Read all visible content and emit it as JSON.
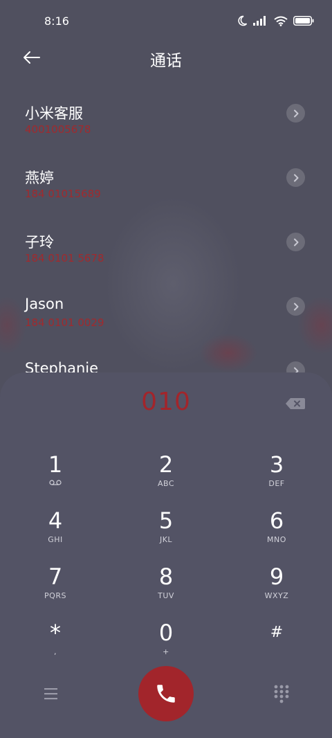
{
  "status_bar": {
    "time": "8:16"
  },
  "header": {
    "title": "通话"
  },
  "contacts": [
    {
      "name": "小米客服",
      "number": "4001005678"
    },
    {
      "name": "燕婷",
      "number": "184 01015689"
    },
    {
      "name": "子玲",
      "number": "184 0101 5678"
    },
    {
      "name": "Jason",
      "number": "184 0101 0029"
    },
    {
      "name": "Stephanie",
      "number": ""
    }
  ],
  "dialer": {
    "input_value": "010",
    "keys": [
      {
        "digit": "1",
        "letters": ""
      },
      {
        "digit": "2",
        "letters": "ABC"
      },
      {
        "digit": "3",
        "letters": "DEF"
      },
      {
        "digit": "4",
        "letters": "GHI"
      },
      {
        "digit": "5",
        "letters": "JKL"
      },
      {
        "digit": "6",
        "letters": "MNO"
      },
      {
        "digit": "7",
        "letters": "PQRS"
      },
      {
        "digit": "8",
        "letters": "TUV"
      },
      {
        "digit": "9",
        "letters": "WXYZ"
      },
      {
        "digit": "*",
        "letters": ","
      },
      {
        "digit": "0",
        "letters": "+"
      },
      {
        "digit": "#",
        "letters": ""
      }
    ]
  },
  "colors": {
    "accent": "#a2252b",
    "background": "#50505f"
  },
  "icons": [
    "moon-icon",
    "signal-icon",
    "wifi-icon",
    "battery-icon",
    "back-arrow-icon",
    "chevron-right-icon",
    "backspace-icon",
    "voicemail-icon",
    "menu-icon",
    "phone-icon",
    "dialpad-icon"
  ]
}
